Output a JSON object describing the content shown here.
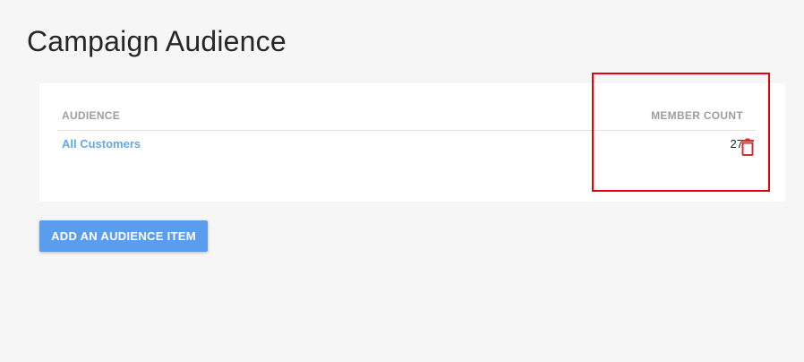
{
  "page": {
    "title": "Campaign Audience"
  },
  "table": {
    "headers": {
      "audience": "AUDIENCE",
      "member_count": "MEMBER COUNT"
    },
    "rows": [
      {
        "audience": "All Customers",
        "member_count": "27",
        "action_icon": "trash-icon"
      }
    ]
  },
  "actions": {
    "add_label": "ADD AN AUDIENCE ITEM"
  },
  "colors": {
    "background": "#f6f6f6",
    "card": "#ffffff",
    "link": "#64a8e8",
    "primary_button": "#5b9ded",
    "delete_icon": "#d32f2f",
    "highlight_outline": "#e8000b",
    "header_text": "#9e9e9e"
  }
}
